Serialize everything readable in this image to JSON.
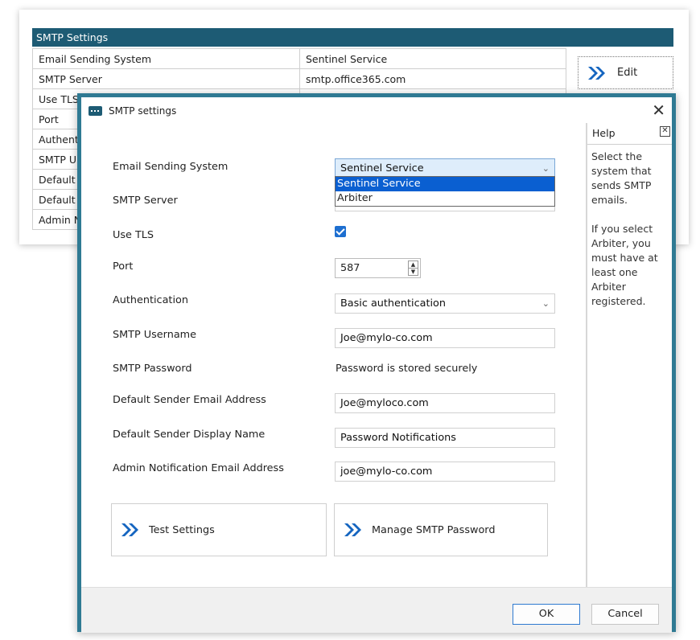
{
  "background_panel": {
    "header": "SMTP Settings",
    "rows": [
      [
        "Email Sending System",
        "Sentinel Service"
      ],
      [
        "SMTP Server",
        "smtp.office365.com"
      ],
      [
        "Use TLS",
        ""
      ],
      [
        "Port",
        ""
      ],
      [
        "Authent",
        ""
      ],
      [
        "SMTP U",
        ""
      ],
      [
        "Default",
        ""
      ],
      [
        "Default",
        ""
      ],
      [
        "Admin N",
        ""
      ]
    ],
    "edit_label": "Edit"
  },
  "dialog": {
    "title": "SMTP settings",
    "close_glyph": "✕",
    "fields": {
      "email_system_label": "Email Sending System",
      "email_system_value": "Sentinel Service",
      "email_system_options": [
        "Sentinel Service",
        "Arbiter"
      ],
      "smtp_server_label": "SMTP Server",
      "use_tls_label": "Use TLS",
      "use_tls_checked": true,
      "port_label": "Port",
      "port_value": "587",
      "auth_label": "Authentication",
      "auth_value": "Basic authentication",
      "username_label": "SMTP Username",
      "username_value": "Joe@mylo-co.com",
      "password_label": "SMTP Password",
      "password_value": "Password is stored securely",
      "sender_email_label": "Default Sender Email Address",
      "sender_email_value": "Joe@myloco.com",
      "sender_name_label": "Default Sender Display Name",
      "sender_name_value": "Password Notifications",
      "admin_email_label": "Admin Notification Email Address",
      "admin_email_value": "joe@mylo-co.com"
    },
    "buttons": {
      "test": "Test Settings",
      "manage": "Manage SMTP Password",
      "ok": "OK",
      "cancel": "Cancel"
    },
    "help": {
      "title": "Help",
      "close_glyph": "✕",
      "para1": "Select the system that sends SMTP emails.",
      "para2": "If you select Arbiter, you must have at least one Arbiter registered."
    }
  },
  "colors": {
    "accent": "#1d5b74",
    "dialog_border": "#2f7a93",
    "chevron_blue": "#1565c0",
    "selection_blue": "#0a5fd1"
  },
  "icons": {
    "chevrons": "double-chevron-right-icon",
    "app": "smtp-app-icon"
  }
}
